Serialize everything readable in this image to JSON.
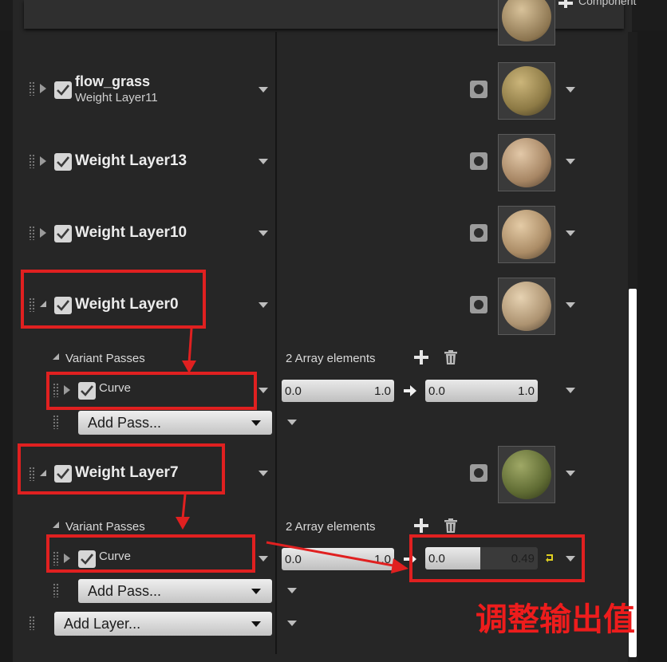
{
  "header": {
    "add_component_label": "Component"
  },
  "layers": [
    {
      "name": "flow_grass",
      "subtitle": "Weight Layer11",
      "expanded": false,
      "thumb_color": "#a68f4e"
    },
    {
      "name": "Weight Layer13",
      "expanded": false,
      "thumb_color": "#c3a27f"
    },
    {
      "name": "Weight Layer10",
      "expanded": false,
      "thumb_color": "#c5a57c"
    },
    {
      "name": "Weight Layer0",
      "expanded": true,
      "thumb_color": "#c7ad88",
      "variant_passes_label": "Variant Passes",
      "array_elements": "2 Array elements",
      "pass": {
        "name": "Curve",
        "in_min": "0.0",
        "in_max": "1.0",
        "out_min": "0.0",
        "out_max": "1.0"
      },
      "add_pass_label": "Add Pass..."
    },
    {
      "name": "Weight Layer7",
      "expanded": true,
      "thumb_color": "#6f7b3c",
      "variant_passes_label": "Variant Passes",
      "array_elements": "2 Array elements",
      "pass": {
        "name": "Curve",
        "in_min": "0.0",
        "in_max": "1.0",
        "out_min": "0.0",
        "out_max": "0.49",
        "out_fraction": 0.49
      },
      "add_pass_label": "Add Pass..."
    }
  ],
  "add_layer_label": "Add Layer...",
  "annotation": {
    "text": "调整输出值",
    "color": "#ee1c1c"
  },
  "colors": {
    "highlight": "#e02020",
    "field": "#d9d9d9",
    "panel": "#262626"
  }
}
